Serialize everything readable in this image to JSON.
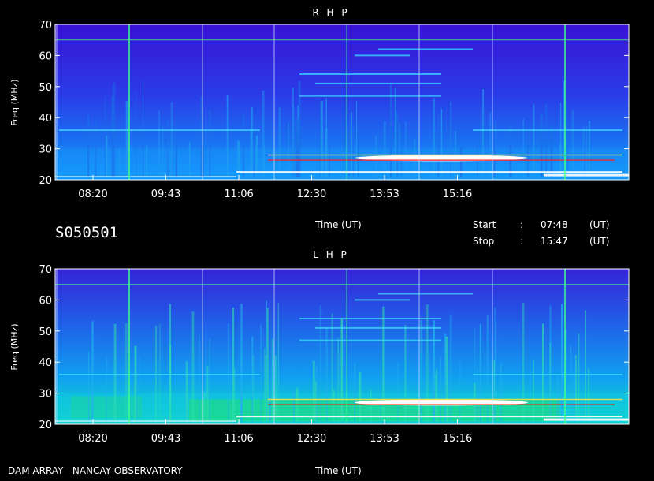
{
  "chart_data": [
    {
      "type": "heatmap",
      "title": "R H P",
      "ylabel": "Freq (MHz)",
      "xlabel": "Time (UT)",
      "ylim": [
        20,
        70
      ],
      "y_ticks": [
        "20",
        "30",
        "40",
        "50",
        "60",
        "70"
      ],
      "x_ticks": [
        "08:20",
        "09:43",
        "11:06",
        "12:30",
        "13:53",
        "15:16"
      ],
      "background_color": "#3a1ad8",
      "low_band_color": "#00c0ff",
      "emission_color": "#ffffff"
    },
    {
      "type": "heatmap",
      "title": "L H P",
      "ylabel": "Freq (MHz)",
      "xlabel": "Time (UT)",
      "ylim": [
        20,
        70
      ],
      "y_ticks": [
        "20",
        "30",
        "40",
        "50",
        "60",
        "70"
      ],
      "x_ticks": [
        "08:20",
        "09:43",
        "11:06",
        "12:30",
        "13:53",
        "15:16"
      ],
      "background_color": "#2f3ce0",
      "low_band_color": "#00ff80",
      "emission_color": "#ffffff"
    }
  ],
  "info": {
    "session_id": "S050501",
    "time_label": "Time (UT)",
    "start_label": "Start",
    "start_sep": ":",
    "start_time": "07:48",
    "start_unit": "(UT)",
    "stop_label": "Stop",
    "stop_sep": ":",
    "stop_time": "15:47",
    "stop_unit": "(UT)"
  },
  "footer": {
    "observatory": "DAM ARRAY   NANCAY OBSERVATORY",
    "time_label": "Time (UT)"
  }
}
